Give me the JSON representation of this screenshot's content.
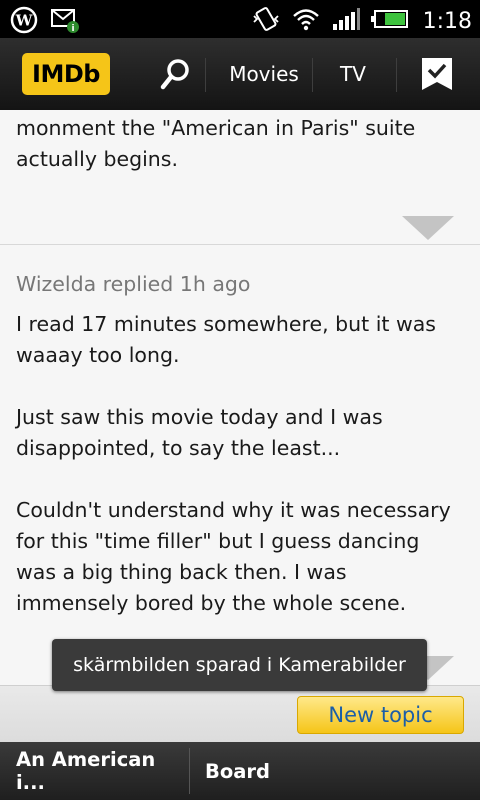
{
  "status_bar": {
    "time": "1:18",
    "icons": [
      "wordpress-icon",
      "mail-icon",
      "vibrate-icon",
      "wifi-icon",
      "signal-icon",
      "battery-icon"
    ]
  },
  "action_bar": {
    "logo_text": "IMDb",
    "nav_movies": "Movies",
    "nav_tv": "TV",
    "icons": [
      "search-icon",
      "watchlist-icon"
    ]
  },
  "posts": [
    {
      "body": [
        "monment the \"American in Paris\" suite actually begins."
      ]
    },
    {
      "author": "Wizelda replied 1h ago",
      "paragraphs": [
        "I read 17 minutes somewhere, but it was waaay too long.",
        "Just saw this movie today and I was disappointed, to say the least...",
        "Couldn't understand why it was necessary for this \"time filler\" but I guess dancing was a big thing back then. I was immensely bored by the whole scene."
      ]
    }
  ],
  "toast": "skärmbilden sparad i Kamerabilder",
  "actions": {
    "new_topic": "New topic"
  },
  "bottom_tabs": {
    "tab1": "An American i...",
    "tab2": "Board"
  },
  "colors": {
    "imdb_yellow": "#f5c518",
    "link_blue": "#1b5ea8"
  }
}
